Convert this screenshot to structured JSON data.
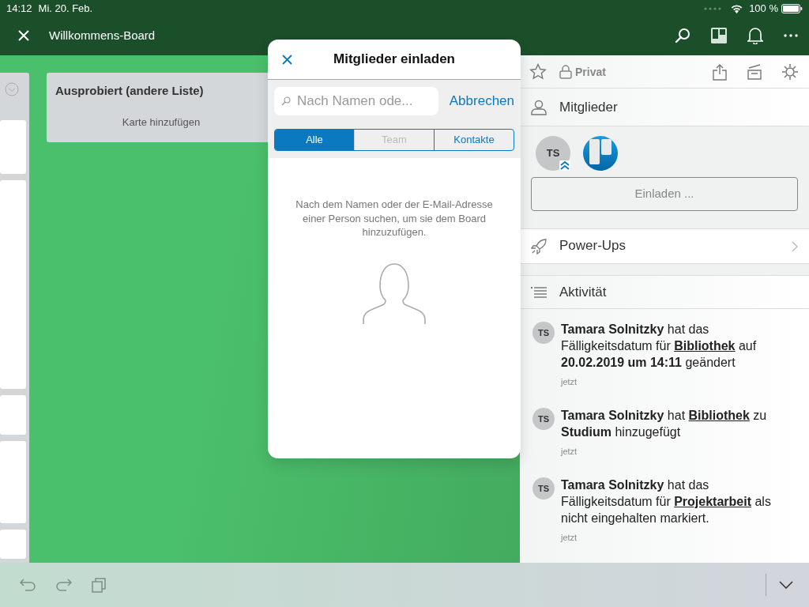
{
  "status_bar": {
    "time": "14:12",
    "date": "Mi. 20. Feb.",
    "battery": "100 %"
  },
  "header": {
    "title": "Willkommens-Board"
  },
  "board": {
    "lists": [
      {
        "title": "Ausprobiert (andere Liste)",
        "add_card": "Karte hinzufügen"
      }
    ]
  },
  "dialog": {
    "title": "Mitglieder einladen",
    "search": {
      "placeholder": "Nach Namen ode..."
    },
    "cancel": "Abbrechen",
    "segments": [
      {
        "label": "Alle",
        "selected": true,
        "disabled": false
      },
      {
        "label": "Team",
        "selected": false,
        "disabled": true
      },
      {
        "label": "Kontakte",
        "selected": false,
        "disabled": false
      }
    ],
    "hint": "Nach dem Namen oder der E-Mail-Adresse einer Person suchen, um sie dem Board hinzuzufügen."
  },
  "panel": {
    "visibility": "Privat",
    "members_heading": "Mitglieder",
    "members": [
      {
        "kind": "initials",
        "initials": "TS",
        "admin": true
      },
      {
        "kind": "logo",
        "admin": false
      }
    ],
    "invite": "Einladen ...",
    "powerups": "Power-Ups",
    "activity_heading": "Aktivität",
    "activities": [
      {
        "avatar": "TS",
        "time": "jetzt",
        "parts": [
          {
            "kind": "bold",
            "text": "Tamara Solnitzky"
          },
          {
            "kind": "plain",
            "text": " hat das Fälligkeitsdatum für "
          },
          {
            "kind": "link",
            "text": "Bibliothek"
          },
          {
            "kind": "plain",
            "text": " auf "
          },
          {
            "kind": "bold",
            "text": "20.02.2019 um 14:11"
          },
          {
            "kind": "plain",
            "text": " geändert"
          }
        ]
      },
      {
        "avatar": "TS",
        "time": "jetzt",
        "parts": [
          {
            "kind": "bold",
            "text": "Tamara Solnitzky"
          },
          {
            "kind": "plain",
            "text": " hat "
          },
          {
            "kind": "link",
            "text": "Bibliothek"
          },
          {
            "kind": "plain",
            "text": " zu "
          },
          {
            "kind": "bold",
            "text": "Studium"
          },
          {
            "kind": "plain",
            "text": " hinzugefügt"
          }
        ]
      },
      {
        "avatar": "TS",
        "time": "jetzt",
        "parts": [
          {
            "kind": "bold",
            "text": "Tamara Solnitzky"
          },
          {
            "kind": "plain",
            "text": " hat das Fälligkeitsdatum für "
          },
          {
            "kind": "link",
            "text": "Projektarbeit"
          },
          {
            "kind": "plain",
            "text": " als nicht eingehalten markiert."
          }
        ]
      }
    ]
  }
}
